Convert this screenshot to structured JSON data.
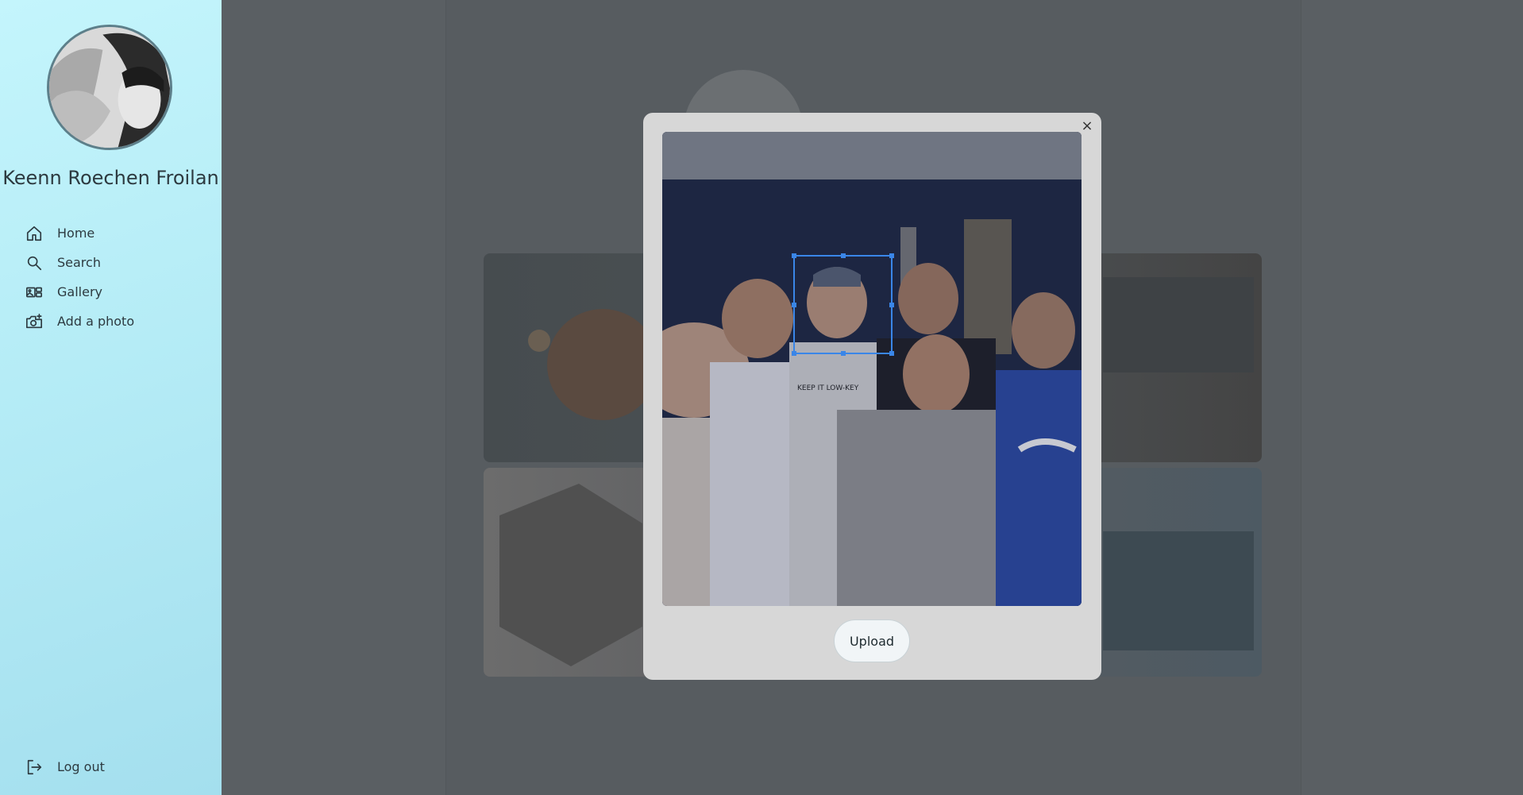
{
  "profile": {
    "name": "Keenn Roechen Froilan"
  },
  "nav": {
    "items": [
      {
        "label": "Home",
        "icon": "home-icon"
      },
      {
        "label": "Search",
        "icon": "search-icon"
      },
      {
        "label": "Gallery",
        "icon": "gallery-icon"
      },
      {
        "label": "Add a photo",
        "icon": "add-photo-icon"
      }
    ],
    "logout": {
      "label": "Log out",
      "icon": "logout-icon"
    }
  },
  "modal": {
    "close_label": "×",
    "upload_label": "Upload",
    "image_caption": "KEEP IT LOW-KEY"
  },
  "colors": {
    "sidebar_gradient_start": "#c4f5fc",
    "sidebar_gradient_end": "#a4dfee",
    "backdrop": "#5a5f63",
    "crop_accent": "#3a86e8"
  }
}
